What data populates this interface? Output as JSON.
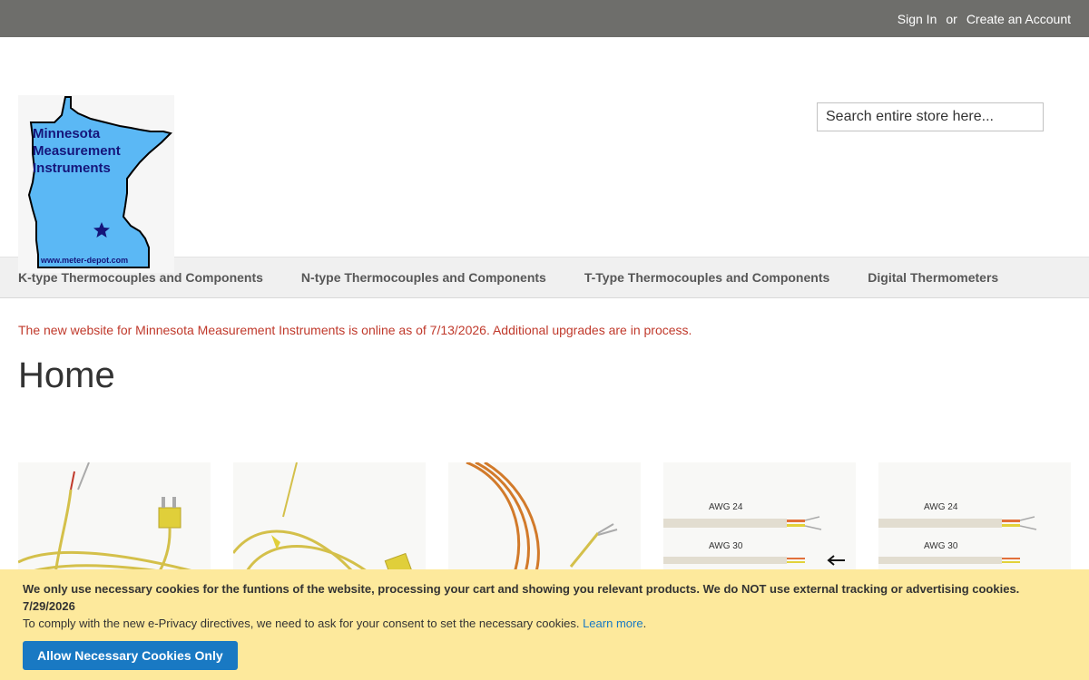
{
  "topbar": {
    "sign_in": "Sign In",
    "or": "or",
    "create_account": "Create an Account"
  },
  "logo": {
    "line1": "Minnesota",
    "line2": "Measurement",
    "line3": "Instruments",
    "url": "www.meter-depot.com"
  },
  "search": {
    "placeholder": "Search entire store here..."
  },
  "nav": {
    "items": [
      "K-type Thermocouples and Components",
      "N-type Thermocouples and Components",
      "T-Type Thermocouples and Components",
      "Digital Thermometers"
    ]
  },
  "notice": "The new website for Minnesota Measurement Instruments is online as of 7/13/2026. Additional upgrades are in process.",
  "page_title": "Home",
  "products": [
    {
      "labels": []
    },
    {
      "labels": []
    },
    {
      "labels": []
    },
    {
      "labels": [
        "AWG 24",
        "AWG 30"
      ]
    },
    {
      "labels": [
        "AWG 24",
        "AWG 30"
      ]
    }
  ],
  "cookie": {
    "message": "We only use necessary cookies for the funtions of the website, processing your cart and showing you relevant products. We do NOT use external tracking or advertising cookies.",
    "date": "7/29/2026",
    "consent_text": "To comply with the new e-Privacy directives, we need to ask for your consent to set the necessary cookies.",
    "learn_more": "Learn more",
    "button": "Allow Necessary Cookies Only"
  },
  "colors": {
    "topbar": "#6e6e6b",
    "notice": "#c0392b",
    "cookie_bg": "#fde99c",
    "button": "#1979c3",
    "logo_fill": "#5bb8f5",
    "logo_text": "#15157a"
  }
}
